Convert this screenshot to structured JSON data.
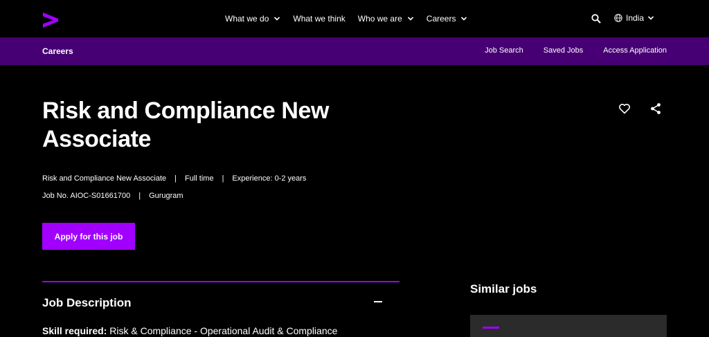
{
  "brand": {
    "accent_color": "#a100ff",
    "subnav_color": "#460073",
    "logo_icon": "accenture-greater-than-logo"
  },
  "topnav": {
    "items": [
      {
        "label": "What we do",
        "has_dropdown": true
      },
      {
        "label": "What we think",
        "has_dropdown": false
      },
      {
        "label": "Who we are",
        "has_dropdown": true
      },
      {
        "label": "Careers",
        "has_dropdown": true
      }
    ],
    "search_icon": "search-icon",
    "country": "India"
  },
  "subnav": {
    "title": "Careers",
    "links": [
      "Job Search",
      "Saved Jobs",
      "Access Application"
    ]
  },
  "job": {
    "title": "Risk and Compliance New Associate",
    "meta_line1": [
      "Risk and Compliance New Associate",
      "Full time",
      "Experience: 0-2 years"
    ],
    "meta_line2": [
      "Job No. AIOC-S01661700",
      "Gurugram"
    ],
    "separator": "|",
    "apply_label": "Apply for this job"
  },
  "job_description": {
    "heading": "Job Description",
    "skill_label": "Skill required:",
    "skill_value": "Risk & Compliance - Operational Audit & Compliance"
  },
  "sidebar": {
    "similar_heading": "Similar jobs"
  }
}
